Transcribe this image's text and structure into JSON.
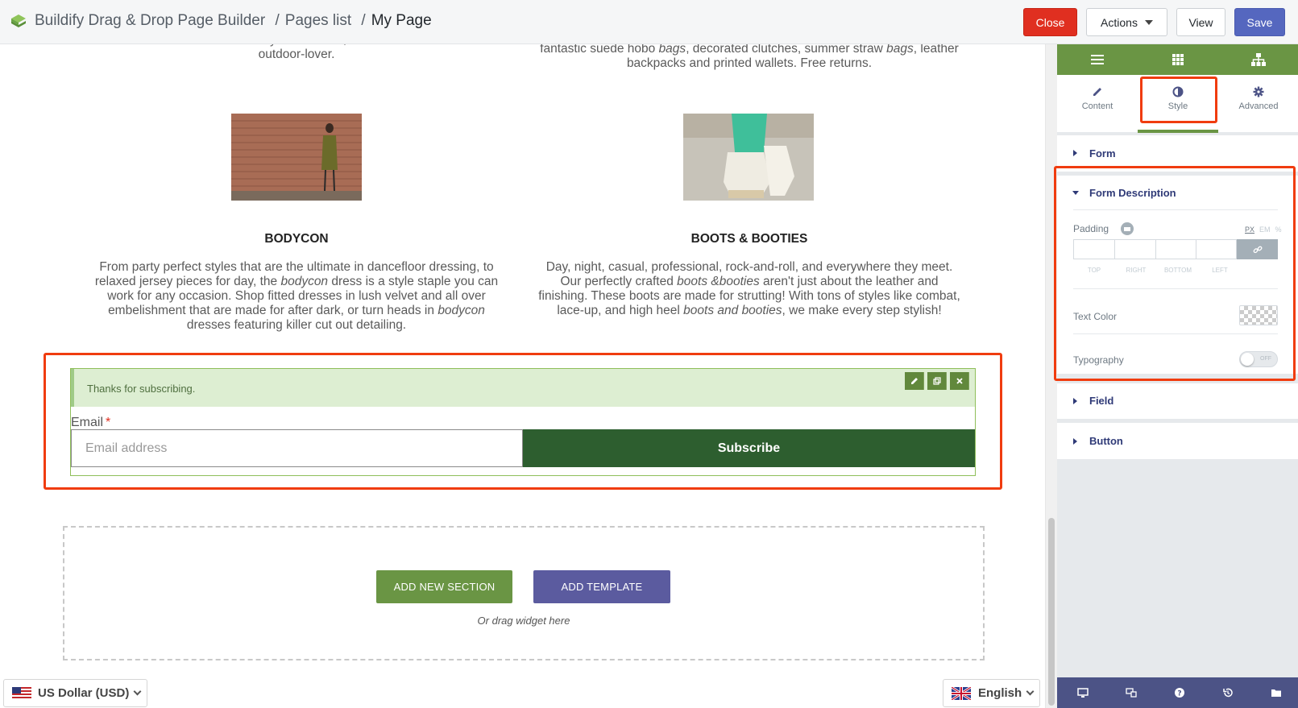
{
  "header": {
    "app_title": "Buildify Drag & Drop Page Builder",
    "separator": "/",
    "crumb_pages": "Pages list",
    "crumb_current": "My Page",
    "close_label": "Close",
    "actions_label": "Actions",
    "view_label": "View",
    "save_label": "Save"
  },
  "canvas": {
    "left_top_text": "outdoor-lover.",
    "right_top_text_html": "fantastic suede hobo <i>bags</i>, decorated clutches, summer straw <i>bags</i>, leather backpacks and printed wallets. Free returns.",
    "left_product": {
      "title": "BODYCON",
      "desc_html": "From party perfect styles that are the ultimate in dancefloor dressing, to relaxed jersey pieces for day, the <i>bodycon</i> dress is a style staple you can work for any occasion. Shop fitted dresses in lush velvet and all over embelishment that are made for after dark, or turn heads in <i>bodycon</i> dresses featuring killer cut out detailing."
    },
    "right_product": {
      "title": "BOOTS & BOOTIES",
      "desc_html": "Day, night, casual, professional, rock-and-roll, and everywhere they meet. Our perfectly crafted <i>boots &amp;booties</i> aren't just about the leather and finishing. These boots are made for strutting! With tons of styles like combat, lace-up, and high heel <i>boots and booties</i>, we make every step stylish!"
    },
    "form": {
      "success_message": "Thanks for subscribing.",
      "email_label": "Email",
      "required_marker": "*",
      "email_placeholder": "Email address",
      "subscribe_label": "Subscribe"
    },
    "dropzone": {
      "add_section_label": "ADD NEW SECTION",
      "add_template_label": "ADD TEMPLATE",
      "hint": "Or drag widget here"
    },
    "currency": "US Dollar (USD)",
    "language": "English"
  },
  "panel": {
    "tabs": [
      {
        "label": "Content",
        "icon": "pencil-icon"
      },
      {
        "label": "Style",
        "icon": "half-circle-icon"
      },
      {
        "label": "Advanced",
        "icon": "gear-icon"
      }
    ],
    "active_tab": "Style",
    "sections": {
      "form": "Form",
      "form_description": "Form Description",
      "field": "Field",
      "button": "Button"
    },
    "controls": {
      "padding_label": "Padding",
      "units": [
        "PX",
        "EM",
        "%"
      ],
      "active_unit": "PX",
      "dim_labels": [
        "TOP",
        "RIGHT",
        "BOTTOM",
        "LEFT"
      ],
      "text_color_label": "Text Color",
      "typography_label": "Typography",
      "typography_toggle": "OFF"
    }
  },
  "colors": {
    "brand_green": "#6a9544",
    "subscribe_green": "#2d5e2f",
    "close_red": "#e02f20",
    "save_blue": "#5567bf",
    "highlight_red": "#f03c0f",
    "panel_footer": "#4c5386"
  }
}
